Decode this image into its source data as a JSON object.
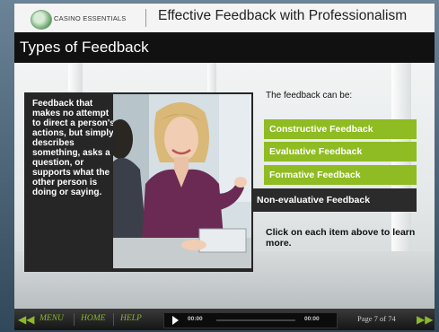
{
  "header": {
    "logo_text": "CASINO ESSENTIALS",
    "course_title": "Effective Feedback with Professionalism"
  },
  "page_title": "Types of Feedback",
  "definition": "Feedback that makes no attempt to direct a person's actions, but simply describes something, asks a question, or supports what the other person is doing or saying.",
  "intro": "The feedback can be:",
  "feedback_types": [
    {
      "label": "Constructive Feedback",
      "selected": false
    },
    {
      "label": "Evaluative Feedback",
      "selected": false
    },
    {
      "label": "Formative Feedback",
      "selected": false
    },
    {
      "label": "Non-evaluative Feedback",
      "selected": true
    }
  ],
  "instruction": "Click on each item above to learn more.",
  "nav": {
    "menu": "MENU",
    "home": "HOME",
    "help": "HELP",
    "time_current": "00:00",
    "time_total": "00:00",
    "page": "Page 7 of 74"
  },
  "colors": {
    "accent_green": "#8fbc22",
    "selected_dark": "#2b2b2b",
    "title_bar": "#111111"
  }
}
